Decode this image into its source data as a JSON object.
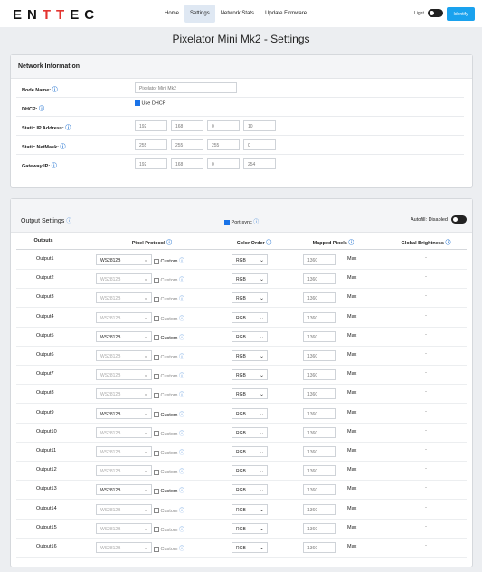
{
  "header": {
    "logo": "ENTTEC",
    "nav": [
      "Home",
      "Settings",
      "Network Stats",
      "Update Firmware"
    ],
    "active_nav": 1,
    "light_label": "Light",
    "identify_label": "Identify"
  },
  "page_title": "Pixelator Mini Mk2 - Settings",
  "network": {
    "heading": "Network Information",
    "node_name_label": "Node Name:",
    "node_name": "Pixelator Mini Mk2",
    "dhcp_label": "DHCP:",
    "dhcp_checkbox_label": "Use DHCP",
    "dhcp_checked": true,
    "ip_label": "Static IP Address:",
    "ip": [
      "192",
      "168",
      "0",
      "10"
    ],
    "netmask_label": "Static NetMask:",
    "netmask": [
      "255",
      "255",
      "255",
      "0"
    ],
    "gateway_label": "Gateway IP:",
    "gateway": [
      "192",
      "168",
      "0",
      "254"
    ]
  },
  "output_settings": {
    "heading": "Output Settings",
    "port_sync_label": "Port-sync",
    "port_sync_checked": true,
    "autofill_label": "Autofill: Disabled",
    "columns": [
      "Outputs",
      "Pixel Protocol",
      "Color Order",
      "Mapped Pixels",
      "Global Brightness"
    ],
    "custom_label": "Custom",
    "max_label": "Max",
    "rows": [
      {
        "name": "Output1",
        "protocol": "WS2812B",
        "order": "RGB",
        "pixels": "1360",
        "brightness": "-",
        "enabled": true
      },
      {
        "name": "Output2",
        "protocol": "WS2812B",
        "order": "RGB",
        "pixels": "1360",
        "brightness": "-",
        "enabled": false
      },
      {
        "name": "Output3",
        "protocol": "WS2812B",
        "order": "RGB",
        "pixels": "1360",
        "brightness": "-",
        "enabled": false
      },
      {
        "name": "Output4",
        "protocol": "WS2812B",
        "order": "RGB",
        "pixels": "1360",
        "brightness": "-",
        "enabled": false
      },
      {
        "name": "Output5",
        "protocol": "WS2812B",
        "order": "RGB",
        "pixels": "1360",
        "brightness": "-",
        "enabled": true
      },
      {
        "name": "Output6",
        "protocol": "WS2812B",
        "order": "RGB",
        "pixels": "1360",
        "brightness": "-",
        "enabled": false
      },
      {
        "name": "Output7",
        "protocol": "WS2812B",
        "order": "RGB",
        "pixels": "1360",
        "brightness": "-",
        "enabled": false
      },
      {
        "name": "Output8",
        "protocol": "WS2812B",
        "order": "RGB",
        "pixels": "1360",
        "brightness": "-",
        "enabled": false
      },
      {
        "name": "Output9",
        "protocol": "WS2812B",
        "order": "RGB",
        "pixels": "1360",
        "brightness": "-",
        "enabled": true
      },
      {
        "name": "Output10",
        "protocol": "WS2812B",
        "order": "RGB",
        "pixels": "1360",
        "brightness": "-",
        "enabled": false
      },
      {
        "name": "Output11",
        "protocol": "WS2812B",
        "order": "RGB",
        "pixels": "1360",
        "brightness": "-",
        "enabled": false
      },
      {
        "name": "Output12",
        "protocol": "WS2812B",
        "order": "RGB",
        "pixels": "1360",
        "brightness": "-",
        "enabled": false
      },
      {
        "name": "Output13",
        "protocol": "WS2812B",
        "order": "RGB",
        "pixels": "1360",
        "brightness": "-",
        "enabled": true
      },
      {
        "name": "Output14",
        "protocol": "WS2812B",
        "order": "RGB",
        "pixels": "1360",
        "brightness": "-",
        "enabled": false
      },
      {
        "name": "Output15",
        "protocol": "WS2812B",
        "order": "RGB",
        "pixels": "1360",
        "brightness": "-",
        "enabled": false
      },
      {
        "name": "Output16",
        "protocol": "WS2812B",
        "order": "RGB",
        "pixels": "1360",
        "brightness": "-",
        "enabled": false
      }
    ]
  },
  "colors": {
    "accent": "#1aa2ee",
    "brand_t": "#e3342f",
    "checkbox_on": "#1a73e8"
  }
}
